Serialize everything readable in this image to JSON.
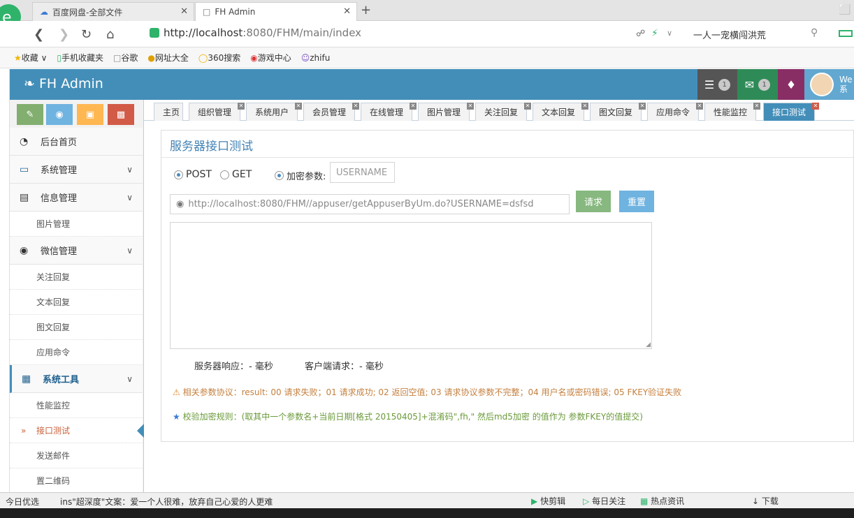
{
  "browser": {
    "tabs": [
      {
        "label": "百度网盘-全部文件",
        "icon": "cloud-icon"
      },
      {
        "label": "FH Admin",
        "icon": "page-icon"
      }
    ],
    "url_host": "http://localhost",
    "url_rest": ":8080/FHM/main/index",
    "search_text": "一人一宠横闯洪荒",
    "bookmarks": [
      "收藏",
      "手机收藏夹",
      "谷歌",
      "网址大全",
      "360搜索",
      "游戏中心",
      "zhifu"
    ]
  },
  "app": {
    "brand": "FH Admin",
    "tasks_count": "1",
    "mail_count": "1",
    "user_greeting": "We",
    "user_sub": "系"
  },
  "sidebar": {
    "menu": [
      {
        "label": "后台首页",
        "icon": "dashboard-icon"
      },
      {
        "label": "系统管理",
        "icon": "desktop-icon"
      },
      {
        "label": "信息管理",
        "icon": "list-icon"
      },
      {
        "label": "微信管理",
        "icon": "comments-icon"
      },
      {
        "label": "系统工具",
        "icon": "grid-icon"
      }
    ],
    "sub_info": [
      "图片管理"
    ],
    "sub_wechat": [
      "关注回复",
      "文本回复",
      "图文回复",
      "应用命令"
    ],
    "sub_tools": [
      "性能监控",
      "接口测试",
      "发送邮件",
      "置二维码"
    ]
  },
  "page_tabs": [
    "主页",
    "组织管理",
    "系统用户",
    "会员管理",
    "在线管理",
    "图片管理",
    "关注回复",
    "文本回复",
    "图文回复",
    "应用命令",
    "性能监控",
    "接口测试"
  ],
  "content": {
    "title": "服务器接口测试",
    "radio_post": "POST",
    "radio_get": "GET",
    "encrypt_label": "加密参数:",
    "encrypt_placeholder": "USERNAME",
    "request_url": "http://localhost:8080/FHM//appuser/getAppuserByUm.do?USERNAME=dsfsd",
    "request_button": "请求",
    "reset_button": "重置",
    "server_response": "服务器响应：- 毫秒",
    "client_request": "客户端请求：- 毫秒",
    "protocol_note": "相关参数协议：result: 00 请求失败；01 请求成功; 02 返回空值; 03 请求协议参数不完整；04 用户名或密码错误; 05 FKEY验证失败",
    "rule_note": "校验加密规则：(取其中一个参数名+当前日期[格式 20150405]+混淆码\",fh,\" 然后md5加密 的值作为 参数FKEY的值提交)"
  },
  "statusbar": {
    "left_items": [
      "今日优选"
    ],
    "news": "ins\"超深度\"文案：爱一个人很难，放弃自己心爱的人更难",
    "right_items": [
      "快剪辑",
      "每日关注",
      "热点资讯",
      "下载"
    ]
  }
}
